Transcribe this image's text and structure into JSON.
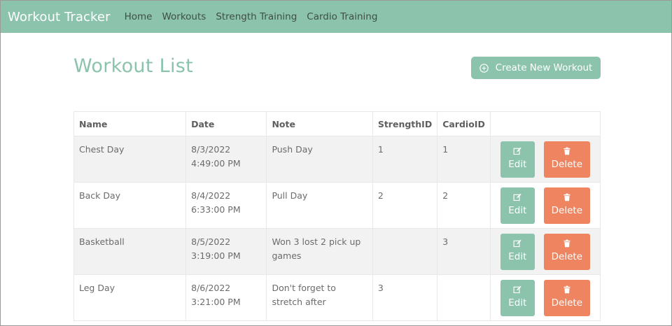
{
  "navbar": {
    "brand": "Workout Tracker",
    "links": [
      "Home",
      "Workouts",
      "Strength Training",
      "Cardio Training"
    ]
  },
  "page": {
    "title": "Workout List",
    "create_button": "Create New Workout",
    "create_icon": "plus-circle-icon"
  },
  "table": {
    "headers": [
      "Name",
      "Date",
      "Note",
      "StrengthID",
      "CardioID",
      ""
    ],
    "rows": [
      {
        "name": "Chest Day",
        "date": "8/3/2022 4:49:00 PM",
        "note": "Push Day",
        "strength_id": "1",
        "cardio_id": "1",
        "edit_label": "Edit",
        "delete_label": "Delete"
      },
      {
        "name": "Back Day",
        "date": "8/4/2022 6:33:00 PM",
        "note": "Pull Day",
        "strength_id": "2",
        "cardio_id": "2",
        "edit_label": "Edit",
        "delete_label": "Delete"
      },
      {
        "name": "Basketball",
        "date": "8/5/2022 3:19:00 PM",
        "note": "Won 3 lost 2 pick up games",
        "strength_id": "",
        "cardio_id": "3",
        "edit_label": "Edit",
        "delete_label": "Delete"
      },
      {
        "name": "Leg Day",
        "date": "8/6/2022 3:21:00 PM",
        "note": "Don't forget to stretch after",
        "strength_id": "3",
        "cardio_id": "",
        "edit_label": "Edit",
        "delete_label": "Delete"
      }
    ]
  },
  "colors": {
    "accent": "#8bc3ad",
    "delete": "#ee8460",
    "stripe": "#f2f2f2"
  }
}
